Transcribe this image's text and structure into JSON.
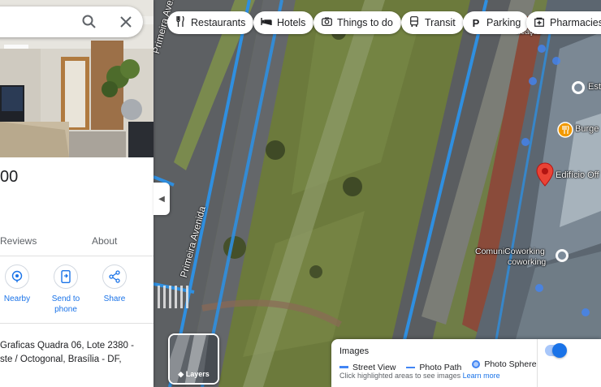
{
  "search": {
    "query": ""
  },
  "place": {
    "title": "00",
    "tabs": [
      {
        "label": "Reviews"
      },
      {
        "label": "About"
      }
    ],
    "actions": [
      {
        "label": "Nearby",
        "icon": "nearby-icon"
      },
      {
        "label_line1": "Send to",
        "label_line2": "phone",
        "icon": "send-to-phone-icon"
      },
      {
        "label": "Share",
        "icon": "share-icon"
      }
    ],
    "address_line1": "Graficas Quadra 06, Lote 2380 -",
    "address_line2": "ste / Octogonal, Brasília - DF,"
  },
  "chips": [
    {
      "label": "Restaurants",
      "icon": "fork-knife-icon"
    },
    {
      "label": "Hotels",
      "icon": "bed-icon"
    },
    {
      "label": "Things to do",
      "icon": "camera-icon"
    },
    {
      "label": "Transit",
      "icon": "bus-icon"
    },
    {
      "label": "Parking",
      "icon": "parking-icon"
    },
    {
      "label": "Pharmacies",
      "icon": "pharmacy-icon"
    }
  ],
  "map": {
    "street_labels": [
      "Primeira Avenida",
      "Primeira Avenida"
    ],
    "markers": [
      {
        "label": "Est",
        "icon": "building-pin-icon"
      },
      {
        "label": "Burge",
        "icon": "restaurant-pin-icon",
        "color": "#f29900"
      },
      {
        "label": "Edifício Off",
        "icon": "red-pin-icon",
        "color": "#ea4335"
      },
      {
        "label_line1": "ComuniCoworking",
        "label_line2": "coworking",
        "icon": "coworking-pin-icon"
      }
    ],
    "top_fragment": "ficação"
  },
  "layers": {
    "label": "Layers"
  },
  "images_legend": {
    "title": "Images",
    "items": [
      {
        "label": "Street View",
        "color": "#4285f4"
      },
      {
        "label": "Photo Path",
        "color": "#4285f4"
      },
      {
        "label": "Photo Sphere",
        "color": "#4285f4"
      }
    ],
    "hint": "Click highlighted areas to see images",
    "hint_link": "Learn more",
    "toggle_on": true
  },
  "colors": {
    "accent": "#1a73e8",
    "street_view_line": "#2f8fe0",
    "pin_red": "#ea4335"
  }
}
